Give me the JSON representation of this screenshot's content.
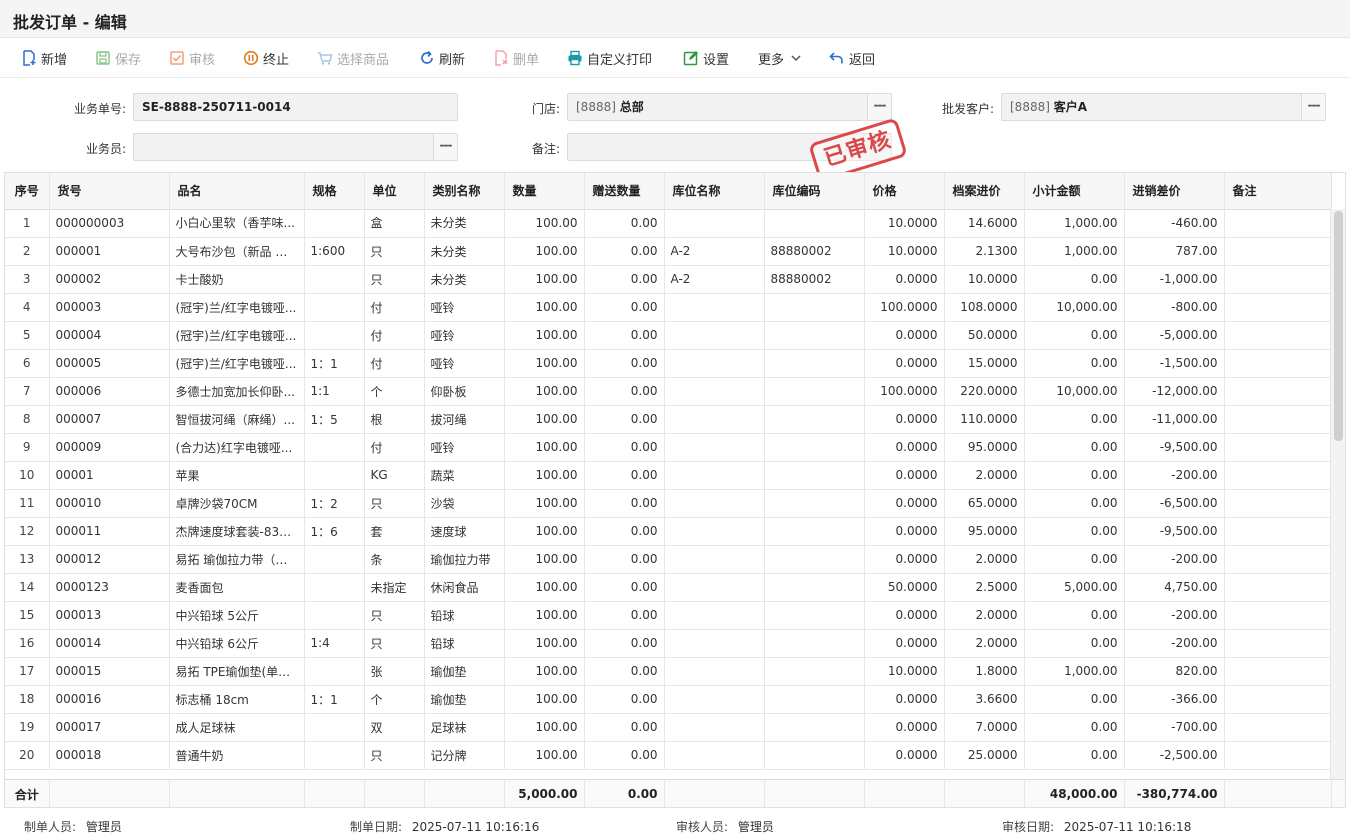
{
  "window": {
    "title": "批发订单 - 编辑"
  },
  "toolbar": {
    "items": [
      {
        "label": "新增",
        "icon": "add-doc-icon",
        "enabled": true
      },
      {
        "label": "保存",
        "icon": "save-icon",
        "enabled": false
      },
      {
        "label": "审核",
        "icon": "approve-icon",
        "enabled": false
      },
      {
        "label": "终止",
        "icon": "terminate-icon",
        "enabled": true
      },
      {
        "label": "选择商品",
        "icon": "cart-icon",
        "enabled": false
      },
      {
        "label": "刷新",
        "icon": "refresh-icon",
        "enabled": true
      },
      {
        "label": "删单",
        "icon": "delete-doc-icon",
        "enabled": false
      },
      {
        "label": "自定义打印",
        "icon": "printer-icon",
        "enabled": true
      },
      {
        "label": "设置",
        "icon": "edit-icon",
        "enabled": true
      },
      {
        "label": "更多",
        "icon": "chevron-down-icon",
        "enabled": true
      },
      {
        "label": "返回",
        "icon": "back-arrow-icon",
        "enabled": true
      }
    ]
  },
  "form": {
    "order_no_label": "业务单号:",
    "order_no": "SE-8888-250711-0014",
    "store_label": "门店:",
    "store_code": "[8888]",
    "store_name": "总部",
    "customer_label": "批发客户:",
    "customer_code": "[8888]",
    "customer_name": "客户A",
    "salesman_label": "业务员:",
    "salesman": "",
    "remark_label": "备注:",
    "remark": "",
    "dots": "---"
  },
  "stamp": {
    "text": "已审核",
    "color": "#d83b3b"
  },
  "table": {
    "columns": [
      "序号",
      "货号",
      "品名",
      "规格",
      "单位",
      "类别名称",
      "数量",
      "赠送数量",
      "库位名称",
      "库位编码",
      "价格",
      "档案进价",
      "小计金额",
      "进销差价",
      "备注"
    ],
    "rows": [
      [
        "1",
        "000000003",
        "小白心里软（香芋味...",
        "",
        "盒",
        "未分类",
        "100.00",
        "0.00",
        "",
        "",
        "10.0000",
        "14.6000",
        "1,000.00",
        "-460.00",
        ""
      ],
      [
        "2",
        "000001",
        "大号布沙包（新品 卡...",
        "1:600",
        "只",
        "未分类",
        "100.00",
        "0.00",
        "A-2",
        "88880002",
        "10.0000",
        "2.1300",
        "1,000.00",
        "787.00",
        ""
      ],
      [
        "3",
        "000002",
        "卡士酸奶",
        "",
        "只",
        "未分类",
        "100.00",
        "0.00",
        "A-2",
        "88880002",
        "0.0000",
        "10.0000",
        "0.00",
        "-1,000.00",
        ""
      ],
      [
        "4",
        "000003",
        "(冠宇)兰/红字电镀哑...",
        "",
        "付",
        "哑铃",
        "100.00",
        "0.00",
        "",
        "",
        "100.0000",
        "108.0000",
        "10,000.00",
        "-800.00",
        ""
      ],
      [
        "5",
        "000004",
        "(冠宇)兰/红字电镀哑...",
        "",
        "付",
        "哑铃",
        "100.00",
        "0.00",
        "",
        "",
        "0.0000",
        "50.0000",
        "0.00",
        "-5,000.00",
        ""
      ],
      [
        "6",
        "000005",
        "(冠宇)兰/红字电镀哑...",
        "1：1",
        "付",
        "哑铃",
        "100.00",
        "0.00",
        "",
        "",
        "0.0000",
        "15.0000",
        "0.00",
        "-1,500.00",
        ""
      ],
      [
        "7",
        "000006",
        "多德士加宽加长仰卧...",
        "1:1",
        "个",
        "仰卧板",
        "100.00",
        "0.00",
        "",
        "",
        "100.0000",
        "220.0000",
        "10,000.00",
        "-12,000.00",
        ""
      ],
      [
        "8",
        "000007",
        "智恒拔河绳（麻绳）...",
        "1：5",
        "根",
        "拔河绳",
        "100.00",
        "0.00",
        "",
        "",
        "0.0000",
        "110.0000",
        "0.00",
        "-11,000.00",
        ""
      ],
      [
        "9",
        "000009",
        "(合力达)红字电镀哑...",
        "",
        "付",
        "哑铃",
        "100.00",
        "0.00",
        "",
        "",
        "0.0000",
        "95.0000",
        "0.00",
        "-9,500.00",
        ""
      ],
      [
        "10",
        "00001",
        "苹果",
        "",
        "KG",
        "蔬菜",
        "100.00",
        "0.00",
        "",
        "",
        "0.0000",
        "2.0000",
        "0.00",
        "-200.00",
        ""
      ],
      [
        "11",
        "000010",
        "卓牌沙袋70CM",
        "1：2",
        "只",
        "沙袋",
        "100.00",
        "0.00",
        "",
        "",
        "0.0000",
        "65.0000",
        "0.00",
        "-6,500.00",
        ""
      ],
      [
        "12",
        "000011",
        "杰牌速度球套装-831...",
        "1：6",
        "套",
        "速度球",
        "100.00",
        "0.00",
        "",
        "",
        "0.0000",
        "95.0000",
        "0.00",
        "-9,500.00",
        ""
      ],
      [
        "13",
        "000012",
        "易拓 瑜伽拉力带（加...",
        "",
        "条",
        "瑜伽拉力带",
        "100.00",
        "0.00",
        "",
        "",
        "0.0000",
        "2.0000",
        "0.00",
        "-200.00",
        ""
      ],
      [
        "14",
        "0000123",
        "麦香面包",
        "",
        "未指定",
        "休闲食品",
        "100.00",
        "0.00",
        "",
        "",
        "50.0000",
        "2.5000",
        "5,000.00",
        "4,750.00",
        ""
      ],
      [
        "15",
        "000013",
        "中兴铅球 5公斤",
        "",
        "只",
        "铅球",
        "100.00",
        "0.00",
        "",
        "",
        "0.0000",
        "2.0000",
        "0.00",
        "-200.00",
        ""
      ],
      [
        "16",
        "000014",
        "中兴铅球 6公斤",
        "1:4",
        "只",
        "铅球",
        "100.00",
        "0.00",
        "",
        "",
        "0.0000",
        "2.0000",
        "0.00",
        "-200.00",
        ""
      ],
      [
        "17",
        "000015",
        "易拓 TPE瑜伽垫(单色...",
        "",
        "张",
        "瑜伽垫",
        "100.00",
        "0.00",
        "",
        "",
        "10.0000",
        "1.8000",
        "1,000.00",
        "820.00",
        ""
      ],
      [
        "18",
        "000016",
        "标志桶 18cm",
        "1：1",
        "个",
        "瑜伽垫",
        "100.00",
        "0.00",
        "",
        "",
        "0.0000",
        "3.6600",
        "0.00",
        "-366.00",
        ""
      ],
      [
        "19",
        "000017",
        "成人足球袜",
        "",
        "双",
        "足球袜",
        "100.00",
        "0.00",
        "",
        "",
        "0.0000",
        "7.0000",
        "0.00",
        "-700.00",
        ""
      ],
      [
        "20",
        "000018",
        "普通牛奶",
        "",
        "只",
        "记分牌",
        "100.00",
        "0.00",
        "",
        "",
        "0.0000",
        "25.0000",
        "0.00",
        "-2,500.00",
        ""
      ]
    ],
    "footer": {
      "label": "合计",
      "quantity": "5,000.00",
      "gift_quantity": "0.00",
      "subtotal": "48,000.00",
      "diff": "-380,774.00"
    }
  },
  "status": {
    "creator_label": "制单人员:",
    "creator": "管理员",
    "create_date_label": "制单日期:",
    "create_date": "2025-07-11 10:16:16",
    "approver_label": "审核人员:",
    "approver": "管理员",
    "approve_date_label": "审核日期:",
    "approve_date": "2025-07-11 10:16:18"
  }
}
